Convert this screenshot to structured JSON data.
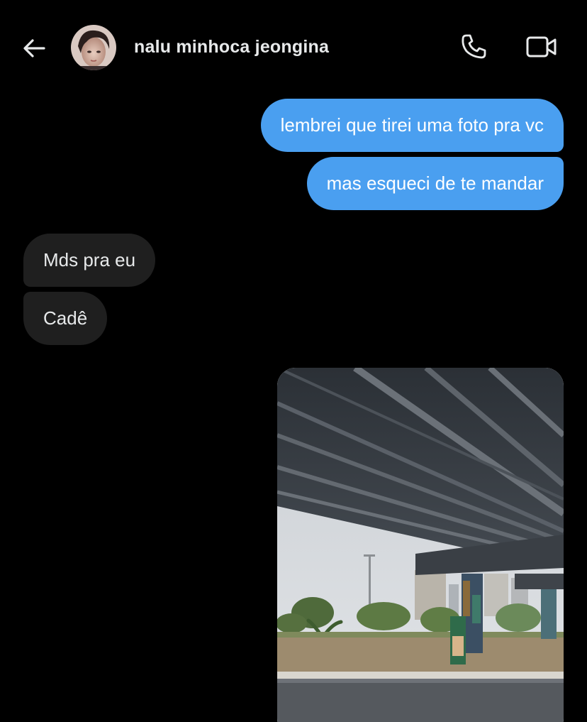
{
  "header": {
    "contact_name": "nalu minhoca jeongina",
    "back_icon": "arrow-left-icon",
    "call_icon": "phone-icon",
    "video_icon": "video-camera-icon"
  },
  "messages": [
    {
      "direction": "sent",
      "text": "lembrei que tirei uma foto pra vc"
    },
    {
      "direction": "sent",
      "text": "mas esqueci de te mandar"
    },
    {
      "direction": "received",
      "text": "Mds pra eu"
    },
    {
      "direction": "received",
      "text": "Cadê"
    }
  ],
  "colors": {
    "background": "#000000",
    "sent_bubble": "#4a9ff0",
    "received_bubble": "#1f1f1f",
    "text": "#ffffff"
  }
}
